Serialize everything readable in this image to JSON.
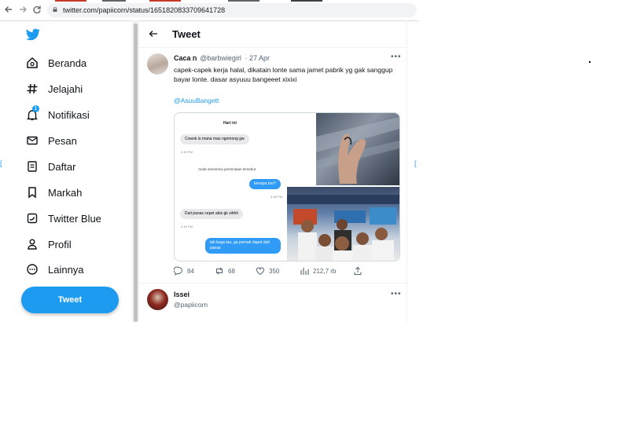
{
  "browser": {
    "url": "twitter.com/papiicorn/status/1651820833709641728",
    "back_icon": "arrow-left-icon",
    "forward_icon": "arrow-right-icon",
    "reload_icon": "reload-icon"
  },
  "sidebar": {
    "logo": "twitter-bird-icon",
    "items": [
      {
        "label": "Beranda",
        "icon": "home-icon"
      },
      {
        "label": "Jelajahi",
        "icon": "hashtag-icon"
      },
      {
        "label": "Notifikasi",
        "icon": "bell-icon",
        "badge": "1"
      },
      {
        "label": "Pesan",
        "icon": "envelope-icon"
      },
      {
        "label": "Daftar",
        "icon": "list-icon"
      },
      {
        "label": "Markah",
        "icon": "bookmark-icon"
      },
      {
        "label": "Twitter Blue",
        "icon": "twitter-blue-icon"
      },
      {
        "label": "Profil",
        "icon": "person-icon"
      },
      {
        "label": "Lainnya",
        "icon": "more-circle-icon"
      }
    ],
    "tweet_button": "Tweet"
  },
  "header": {
    "title": "Tweet"
  },
  "tweet": {
    "author_name": "Caca 𐌿",
    "handle": "@barbwiegirl",
    "date": "· 27 Apr",
    "text": "capek-capek kerja halal, dikatain lonte sama jamet pabrik yg gak sanggup bayar lonte. dasar asyuuu bangeeet xixixi",
    "mention": "@AsuuBangett",
    "chat": {
      "title": "Hari ini",
      "messages": [
        {
          "side": "in",
          "text": "Cowok lu mana mau ngomong gw",
          "time": "3.40 PM"
        },
        {
          "side": "note",
          "text": "Anda menerima permintaan tersebut"
        },
        {
          "side": "out",
          "text": "kenapa bro?",
          "time": "3.48 PM"
        },
        {
          "side": "in",
          "text": "Duit panas cepet abis gk sihhh",
          "time": "3.16 PM"
        },
        {
          "side": "out",
          "text": "lah kuga tau, ga pernah dapet duit panas",
          "time": ""
        }
      ]
    },
    "stats": {
      "replies": "84",
      "retweets": "68",
      "likes": "350",
      "views": "212,7 rb"
    }
  },
  "reply": {
    "name": "Issei",
    "handle": "@papiicorn"
  },
  "colors": {
    "accent": "#1d9bf0",
    "text": "#0f1419",
    "muted": "#536471"
  }
}
